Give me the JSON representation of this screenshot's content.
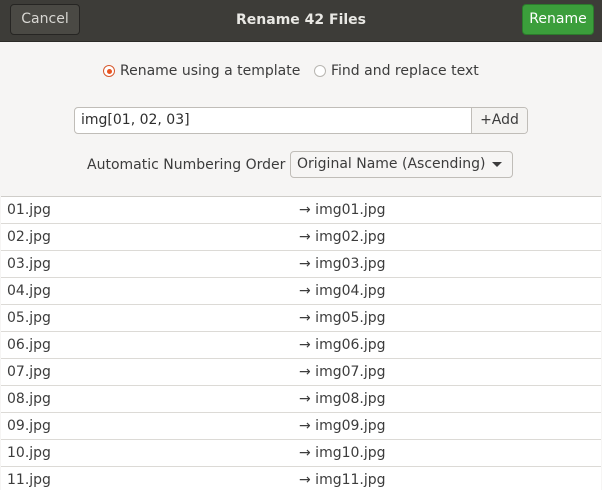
{
  "header": {
    "cancel_label": "Cancel",
    "title": "Rename 42 Files",
    "rename_label": "Rename"
  },
  "mode": {
    "template_label": "Rename using a template",
    "template_selected": true,
    "replace_label": "Find and replace text",
    "replace_selected": false
  },
  "template": {
    "value": "img[01, 02, 03]",
    "add_label": "+Add"
  },
  "numbering": {
    "label": "Automatic Numbering Order",
    "selected": "Original Name (Ascending)"
  },
  "files": [
    {
      "old": "01.jpg",
      "new": "→ img01.jpg"
    },
    {
      "old": "02.jpg",
      "new": "→ img02.jpg"
    },
    {
      "old": "03.jpg",
      "new": "→ img03.jpg"
    },
    {
      "old": "04.jpg",
      "new": "→ img04.jpg"
    },
    {
      "old": "05.jpg",
      "new": "→ img05.jpg"
    },
    {
      "old": "06.jpg",
      "new": "→ img06.jpg"
    },
    {
      "old": "07.jpg",
      "new": "→ img07.jpg"
    },
    {
      "old": "08.jpg",
      "new": "→ img08.jpg"
    },
    {
      "old": "09.jpg",
      "new": "→ img09.jpg"
    },
    {
      "old": "10.jpg",
      "new": "→ img10.jpg"
    },
    {
      "old": "11.jpg",
      "new": "→ img11.jpg"
    }
  ],
  "colors": {
    "headerbar": "#3d3c38",
    "suggested_action": "#3b9e3b",
    "radio_accent": "#e95420"
  }
}
